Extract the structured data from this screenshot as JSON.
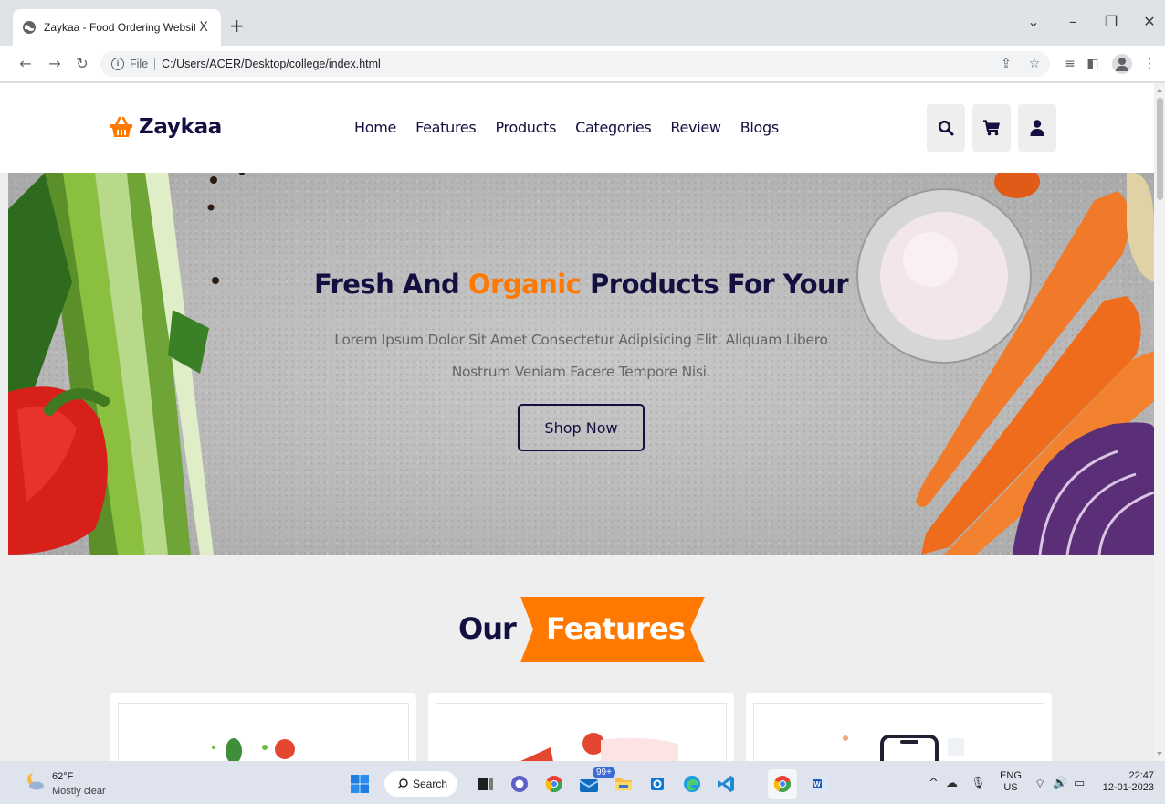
{
  "browser": {
    "tab_title": "Zaykaa - Food Ordering Website",
    "tab_close": "X",
    "new_tab": "+",
    "omnibox_scheme": "File",
    "omnibox_url": "C:/Users/ACER/Desktop/college/index.html"
  },
  "site": {
    "logo_text": "Zaykaa",
    "nav": [
      "Home",
      "Features",
      "Products",
      "Categories",
      "Review",
      "Blogs"
    ],
    "header_icons": [
      "search-icon",
      "cart-icon",
      "user-icon"
    ],
    "colors": {
      "primary": "#130f40",
      "accent": "#ff7800",
      "muted": "#666666",
      "section_bg": "#eeeeee"
    }
  },
  "hero": {
    "title_before": "Fresh And ",
    "title_accent": "Organic",
    "title_after": " Products For Your",
    "subtitle": "Lorem Ipsum Dolor Sit Amet Consectetur Adipisicing Elit. Aliquam Libero Nostrum Veniam Facere Tempore Nisi.",
    "cta": "Shop Now"
  },
  "features": {
    "heading_plain": "Our",
    "heading_ribbon": "Features"
  },
  "taskbar": {
    "weather_temp": "62°F",
    "weather_desc": "Mostly clear",
    "search_label": "Search",
    "mail_badge": "99+",
    "lang_line1": "ENG",
    "lang_line2": "US",
    "time": "22:47",
    "date": "12-01-2023"
  }
}
